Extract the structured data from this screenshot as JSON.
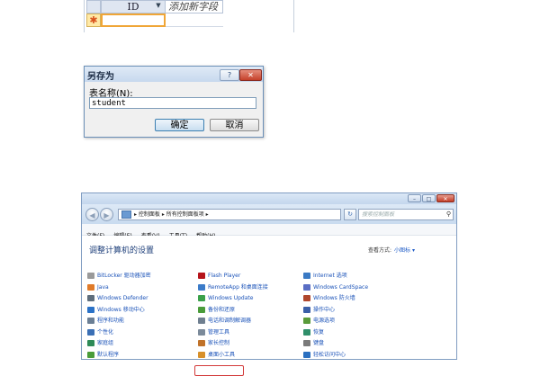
{
  "table": {
    "column_id": "ID",
    "column_new": "添加新字段",
    "new_row_marker": "✱",
    "dropdown_glyph": "▼"
  },
  "dialog": {
    "title": "另存为",
    "help_glyph": "?",
    "close_glyph": "✕",
    "label": "表名称(N):",
    "value": "student",
    "ok": "确定",
    "cancel": "取消"
  },
  "control_panel": {
    "window_buttons": [
      "–",
      "□",
      "✕"
    ],
    "back_glyph": "◀",
    "forward_glyph": "▶",
    "address": "▸ 控制面板 ▸ 所有控制面板项 ▸",
    "address_drop": "▾",
    "refresh_glyph": "↻",
    "search_placeholder": "搜索控制面板",
    "search_glyph": "⚲",
    "menu": [
      "文件(F)",
      "编辑(E)",
      "查看(V)",
      "工具(T)",
      "帮助(H)"
    ],
    "heading": "调整计算机的设置",
    "view_by_label": "查看方式:",
    "view_by_value": "小图标 ▾",
    "col1": [
      {
        "label": "BitLocker 驱动器加密",
        "color": "#9a9a9a"
      },
      {
        "label": "Java",
        "color": "#e07b2a"
      },
      {
        "label": "Windows Defender",
        "color": "#5e6e7d"
      },
      {
        "label": "Windows 移动中心",
        "color": "#2b72c7"
      },
      {
        "label": "程序和功能",
        "color": "#6b7f95"
      },
      {
        "label": "个性化",
        "color": "#3a6fb5"
      },
      {
        "label": "家庭组",
        "color": "#2e8b57"
      },
      {
        "label": "默认程序",
        "color": "#4a9c3a"
      }
    ],
    "col2": [
      {
        "label": "Flash Player",
        "color": "#b5141b"
      },
      {
        "label": "RemoteApp 和桌面连接",
        "color": "#3b7bc9"
      },
      {
        "label": "Windows Update",
        "color": "#3aa14a"
      },
      {
        "label": "备份和还原",
        "color": "#4a9c3a"
      },
      {
        "label": "电话和调制解调器",
        "color": "#6f7f90"
      },
      {
        "label": "管理工具",
        "color": "#7b8a9a"
      },
      {
        "label": "家长控制",
        "color": "#c0722a"
      },
      {
        "label": "桌面小工具",
        "color": "#d8902a"
      }
    ],
    "col3": [
      {
        "label": "Internet 选项",
        "color": "#3a7ac4"
      },
      {
        "label": "Windows CardSpace",
        "color": "#5a6ec4"
      },
      {
        "label": "Windows 防火墙",
        "color": "#b0472c"
      },
      {
        "label": "操作中心",
        "color": "#3b5fa8"
      },
      {
        "label": "电源选项",
        "color": "#5a9b3a"
      },
      {
        "label": "恢复",
        "color": "#2f8f6a"
      },
      {
        "label": "键盘",
        "color": "#7a7a7a"
      },
      {
        "label": "轻松访问中心",
        "color": "#2a6fc0"
      }
    ]
  }
}
